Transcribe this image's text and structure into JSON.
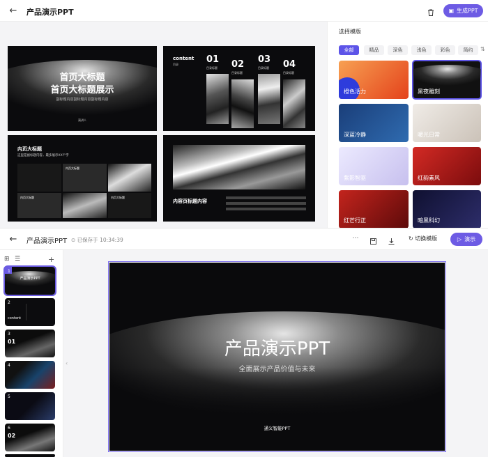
{
  "top_window": {
    "title": "产品演示PPT",
    "generate_label": "生成PPT"
  },
  "preview_slides": {
    "s1": {
      "title1": "首页大标题",
      "title2": "首页大标题展示",
      "subtitle": "副标题内容副标题内容副标题内容",
      "presenter": "演讲人"
    },
    "s2": {
      "content": "content",
      "content_sub": "目录",
      "items": [
        {
          "num": "01",
          "label": "目录标题"
        },
        {
          "num": "02",
          "label": "目录标题"
        },
        {
          "num": "03",
          "label": "目录标题"
        },
        {
          "num": "04",
          "label": "目录标题"
        }
      ]
    },
    "s3": {
      "title": "内页大标题",
      "subtitle": "这里是副标题内容，最多展示XX个字",
      "card_title": "内页大标题"
    },
    "s4": {
      "title": "内容页标题内容"
    }
  },
  "template_panel": {
    "heading": "选择模版",
    "filters": [
      "全部",
      "精品",
      "深色",
      "浅色",
      "彩色",
      "简约"
    ],
    "templates": [
      {
        "name": "橙色活力",
        "color": "#f06a2a"
      },
      {
        "name": "黑夜雕刻",
        "color": "#151517"
      },
      {
        "name": "深蓝冷静",
        "color": "#1f4f8e"
      },
      {
        "name": "暖光日常",
        "color": "#d8d2cc"
      },
      {
        "name": "紫影智驱",
        "color": "#d9d4f0"
      },
      {
        "name": "红韵素风",
        "color": "#b3171b"
      },
      {
        "name": "红芒行正",
        "color": "#8e1111"
      },
      {
        "name": "暗黑科幻",
        "color": "#1a1b3f"
      }
    ]
  },
  "editor": {
    "title": "产品演示PPT",
    "saved_status": "已保存于 10:34:39",
    "switch_template": "切换模版",
    "present": "演示"
  },
  "thumbnails": [
    "1",
    "2",
    "3",
    "4",
    "5",
    "6"
  ],
  "main_slide": {
    "title": "产品演示PPT",
    "subtitle": "全面展示产品价值与未来",
    "footer": "通义智能PPT"
  },
  "thumb_texts": {
    "t2": "content",
    "t3": "01",
    "t6": "02"
  }
}
